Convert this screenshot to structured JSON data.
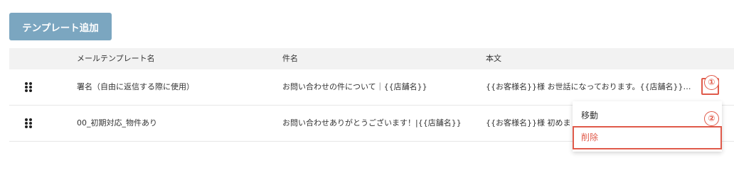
{
  "toolbar": {
    "add_template_label": "テンプレート追加"
  },
  "table": {
    "columns": [
      "メールテンプレート名",
      "件名",
      "本文"
    ],
    "rows": [
      {
        "name": "署名（自由に返信する際に使用）",
        "subject": "お問い合わせの件について｜{{店舗名}}",
        "body": "{{お客様名}}様 お世話になっております。{{店舗名}}…"
      },
      {
        "name": "00_初期対応_物件あり",
        "subject": "お問い合わせありがとうございます！|{{店舗名}}",
        "body": "{{お客様名}}様 初めまして"
      }
    ]
  },
  "actions": {
    "more_label": "···"
  },
  "menu": {
    "move_label": "移動",
    "delete_label": "削除"
  },
  "annotations": {
    "step1": "①",
    "step2": "②"
  },
  "colors": {
    "button_bg": "#7ba6c0",
    "header_bg": "#f2f2f2",
    "highlight": "#e05a4a"
  }
}
